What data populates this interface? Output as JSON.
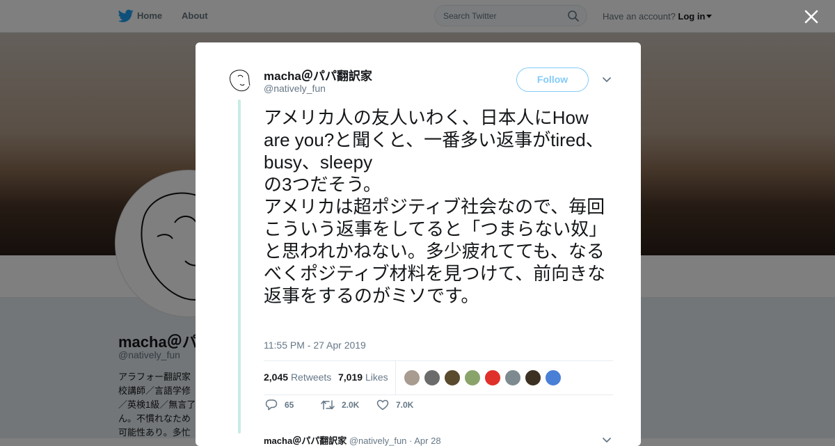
{
  "topbar": {
    "home_label": "Home",
    "about_label": "About",
    "search_placeholder": "Search Twitter",
    "account_prompt": "Have an account?",
    "login_label": "Log in"
  },
  "profile": {
    "name_truncated": "macha＠パ",
    "handle": "@natively_fun",
    "bio_lines": [
      "アラフォー翻訳家",
      "校講師／言語学修",
      "／英検1級／無言了",
      "ん。不慣れなため",
      "可能性あり。多忙"
    ]
  },
  "tweet": {
    "author_name": "macha＠パパ翻訳家",
    "author_handle": "@natively_fun",
    "follow_label": "Follow",
    "text": "アメリカ人の友人いわく、日本人にHow are you?と聞くと、一番多い返事がtired、busy、sleepy\nの3つだそう。\nアメリカは超ポジティブ社会なので、毎回こういう返事をしてると「つまらない奴」と思われかねない。多少疲れてても、なるべくポジティブ材料を見つけて、前向きな返事をするのがミソです。",
    "timestamp": "11:55 PM - 27 Apr 2019",
    "retweets_count": "2,045",
    "retweets_label": "Retweets",
    "likes_count": "7,019",
    "likes_label": "Likes",
    "reply_count": "65",
    "retweet_action_count": "2.0K",
    "like_action_count": "7.0K",
    "likers_colors": [
      "#a89b8f",
      "#6b6b6b",
      "#5a4a2e",
      "#8aa36b",
      "#e0302a",
      "#7d8a8f",
      "#3b3022",
      "#4a7fd6"
    ]
  },
  "next_reply": {
    "author_name": "macha＠パパ翻訳家",
    "author_handle": "@natively_fun",
    "date": "· Apr 28"
  },
  "colors": {
    "brand": "#1da1f2",
    "thread_line": "#c7ede4"
  }
}
